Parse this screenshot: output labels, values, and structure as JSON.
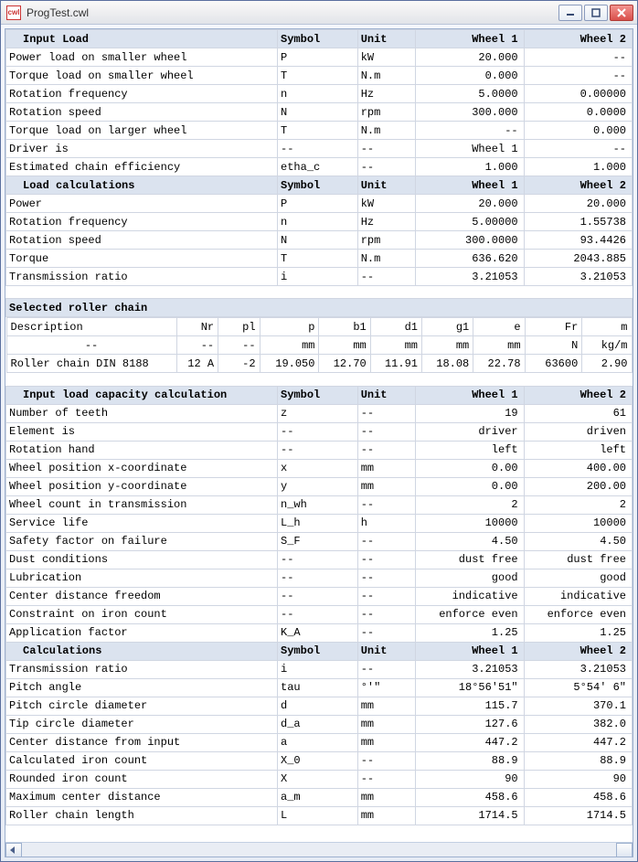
{
  "window": {
    "title": "ProgTest.cwl"
  },
  "sections": {
    "input_load": {
      "title": "Input Load",
      "cols": {
        "symbol": "Symbol",
        "unit": "Unit",
        "w1": "Wheel 1",
        "w2": "Wheel 2"
      },
      "rows": [
        {
          "label": "Power load on smaller wheel",
          "symbol": "P",
          "unit": "kW",
          "w1": "20.000",
          "w2": "--"
        },
        {
          "label": "Torque load on smaller wheel",
          "symbol": "T",
          "unit": "N.m",
          "w1": "0.000",
          "w2": "--"
        },
        {
          "label": "Rotation frequency",
          "symbol": "n",
          "unit": "Hz",
          "w1": "5.0000",
          "w2": "0.00000"
        },
        {
          "label": "Rotation speed",
          "symbol": "N",
          "unit": "rpm",
          "w1": "300.000",
          "w2": "0.0000"
        },
        {
          "label": "Torque load on larger wheel",
          "symbol": "T",
          "unit": "N.m",
          "w1": "--",
          "w2": "0.000"
        },
        {
          "label": "Driver is",
          "symbol": "--",
          "unit": "--",
          "w1": "Wheel 1",
          "w2": "--"
        },
        {
          "label": "Estimated chain efficiency",
          "symbol": "etha_c",
          "unit": "--",
          "w1": "1.000",
          "w2": "1.000"
        }
      ]
    },
    "load_calc": {
      "title": "Load calculations",
      "cols": {
        "symbol": "Symbol",
        "unit": "Unit",
        "w1": "Wheel 1",
        "w2": "Wheel 2"
      },
      "rows": [
        {
          "label": "Power",
          "symbol": "P",
          "unit": "kW",
          "w1": "20.000",
          "w2": "20.000"
        },
        {
          "label": "Rotation frequency",
          "symbol": "n",
          "unit": "Hz",
          "w1": "5.00000",
          "w2": "1.55738"
        },
        {
          "label": "Rotation speed",
          "symbol": "N",
          "unit": "rpm",
          "w1": "300.0000",
          "w2": "93.4426"
        },
        {
          "label": "Torque",
          "symbol": "T",
          "unit": "N.m",
          "w1": "636.620",
          "w2": "2043.885"
        },
        {
          "label": "Transmission ratio",
          "symbol": "i",
          "unit": "--",
          "w1": "3.21053",
          "w2": "3.21053"
        }
      ]
    },
    "roller": {
      "title": "Selected roller chain",
      "headers": [
        "Description",
        "Nr",
        "pl",
        "p",
        "b1",
        "d1",
        "g1",
        "e",
        "Fr",
        "m"
      ],
      "units": [
        "--",
        "--",
        "--",
        "mm",
        "mm",
        "mm",
        "mm",
        "mm",
        "N",
        "kg/m"
      ],
      "row": [
        "Roller chain DIN 8188",
        "12 A",
        "-2",
        "19.050",
        "12.70",
        "11.91",
        "18.08",
        "22.78",
        "63600",
        "2.90"
      ]
    },
    "cap_input": {
      "title": "Input load capacity calculation",
      "cols": {
        "symbol": "Symbol",
        "unit": "Unit",
        "w1": "Wheel 1",
        "w2": "Wheel 2"
      },
      "rows": [
        {
          "label": "Number of teeth",
          "symbol": "z",
          "unit": "--",
          "w1": "19",
          "w2": "61"
        },
        {
          "label": "Element is",
          "symbol": "--",
          "unit": "--",
          "w1": "driver",
          "w2": "driven"
        },
        {
          "label": "Rotation hand",
          "symbol": "--",
          "unit": "--",
          "w1": "left",
          "w2": "left"
        },
        {
          "label": "Wheel position x-coordinate",
          "symbol": "x",
          "unit": "mm",
          "w1": "0.00",
          "w2": "400.00"
        },
        {
          "label": "Wheel position y-coordinate",
          "symbol": "y",
          "unit": "mm",
          "w1": "0.00",
          "w2": "200.00"
        },
        {
          "label": "Wheel count in transmission",
          "symbol": "n_wh",
          "unit": "--",
          "w1": "2",
          "w2": "2"
        },
        {
          "label": "Service life",
          "symbol": "L_h",
          "unit": "h",
          "w1": "10000",
          "w2": "10000"
        },
        {
          "label": "Safety factor on failure",
          "symbol": "S_F",
          "unit": "--",
          "w1": "4.50",
          "w2": "4.50"
        },
        {
          "label": "Dust conditions",
          "symbol": "--",
          "unit": "--",
          "w1": "dust free",
          "w2": "dust free"
        },
        {
          "label": "Lubrication",
          "symbol": "--",
          "unit": "--",
          "w1": "good",
          "w2": "good"
        },
        {
          "label": "Center distance freedom",
          "symbol": "--",
          "unit": "--",
          "w1": "indicative",
          "w2": "indicative"
        },
        {
          "label": "Constraint on iron count",
          "symbol": "--",
          "unit": "--",
          "w1": "enforce even",
          "w2": "enforce even"
        },
        {
          "label": "Application factor",
          "symbol": "K_A",
          "unit": "--",
          "w1": "1.25",
          "w2": "1.25"
        }
      ]
    },
    "calcs": {
      "title": "Calculations",
      "cols": {
        "symbol": "Symbol",
        "unit": "Unit",
        "w1": "Wheel 1",
        "w2": "Wheel 2"
      },
      "rows": [
        {
          "label": "Transmission ratio",
          "symbol": "i",
          "unit": "--",
          "w1": "3.21053",
          "w2": "3.21053"
        },
        {
          "label": "Pitch angle",
          "symbol": "tau",
          "unit": "°'\"",
          "w1": "18°56'51\"",
          "w2": "5°54' 6\""
        },
        {
          "label": "Pitch circle diameter",
          "symbol": "d",
          "unit": "mm",
          "w1": "115.7",
          "w2": "370.1"
        },
        {
          "label": "Tip circle diameter",
          "symbol": "d_a",
          "unit": "mm",
          "w1": "127.6",
          "w2": "382.0"
        },
        {
          "label": "Center distance from input",
          "symbol": "a",
          "unit": "mm",
          "w1": "447.2",
          "w2": "447.2"
        },
        {
          "label": "Calculated iron count",
          "symbol": "X_0",
          "unit": "--",
          "w1": "88.9",
          "w2": "88.9"
        },
        {
          "label": "Rounded iron count",
          "symbol": "X",
          "unit": "--",
          "w1": "90",
          "w2": "90"
        },
        {
          "label": "Maximum center distance",
          "symbol": "a_m",
          "unit": "mm",
          "w1": "458.6",
          "w2": "458.6"
        },
        {
          "label": "Roller chain length",
          "symbol": "L",
          "unit": "mm",
          "w1": "1714.5",
          "w2": "1714.5"
        }
      ]
    }
  }
}
